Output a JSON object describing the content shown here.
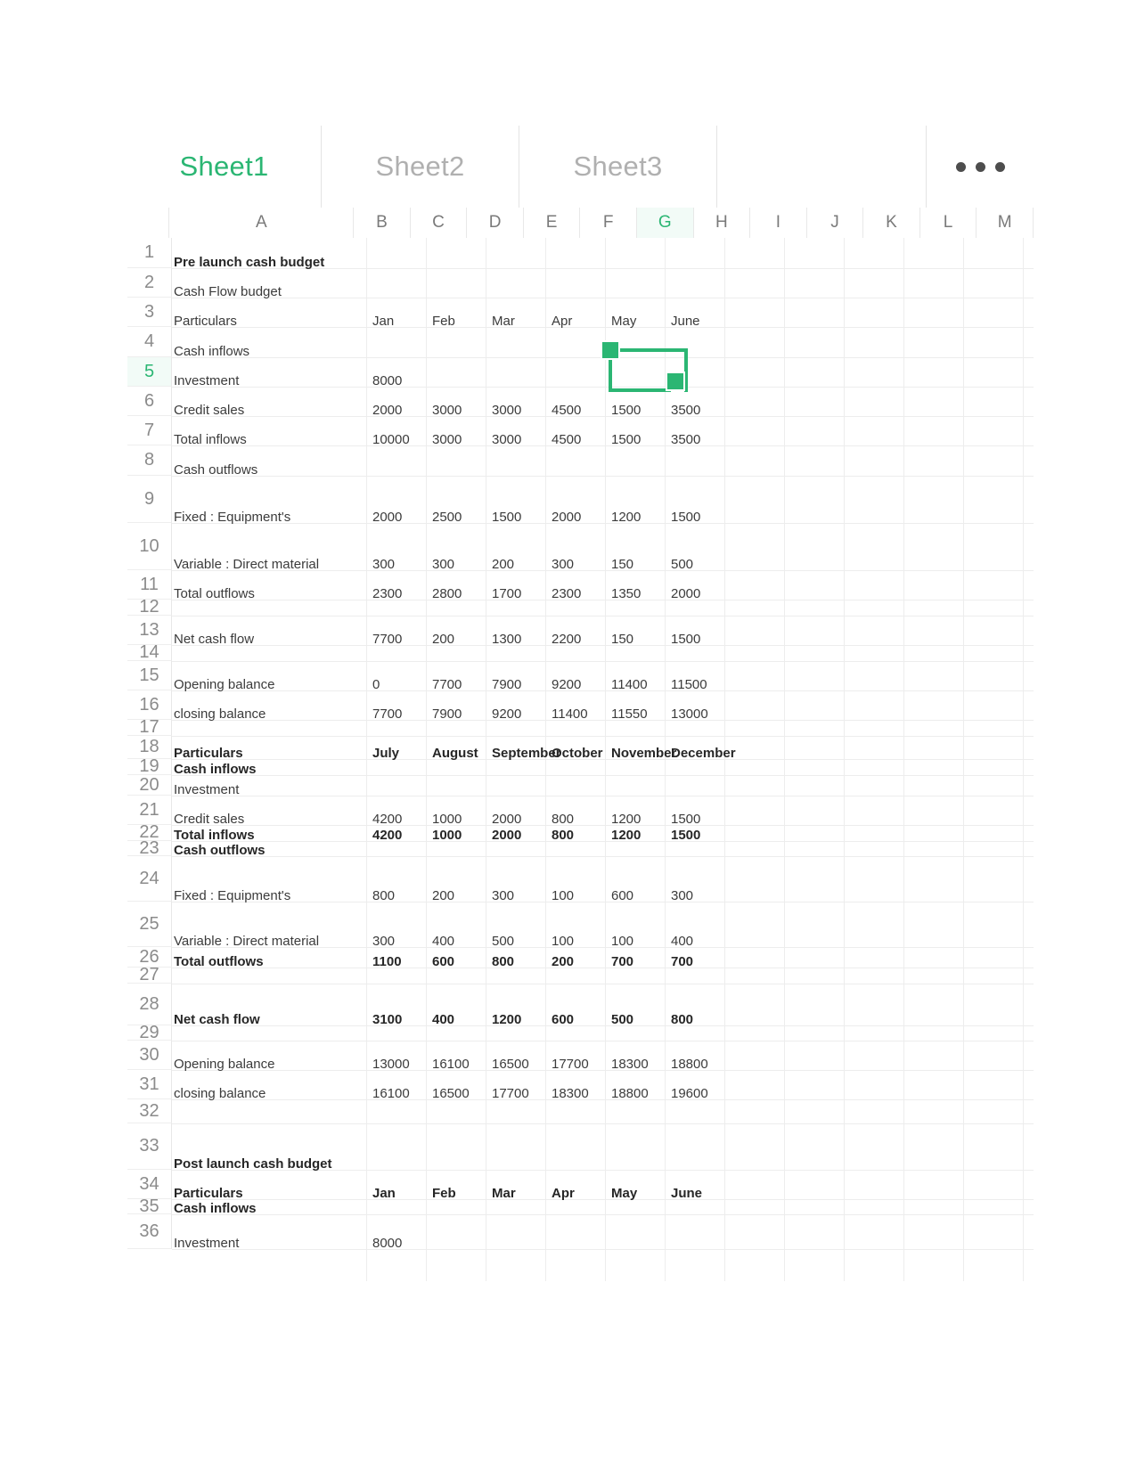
{
  "app": {
    "selected_cell_range": "G5:H6",
    "accent_color": "#2bb673",
    "grid_line_color": "#ededed",
    "header_text_color": "#7a7a7a"
  },
  "tabs": [
    {
      "label": "Sheet1",
      "active": true
    },
    {
      "label": "Sheet2",
      "active": false
    },
    {
      "label": "Sheet3",
      "active": false
    },
    {
      "label": "",
      "active": false
    }
  ],
  "more_menu": {
    "name": "more-options",
    "glyph": "•••"
  },
  "columns": [
    {
      "label": "A",
      "selected": false
    },
    {
      "label": "B",
      "selected": false
    },
    {
      "label": "C",
      "selected": false
    },
    {
      "label": "D",
      "selected": false
    },
    {
      "label": "E",
      "selected": false
    },
    {
      "label": "F",
      "selected": false
    },
    {
      "label": "G",
      "selected": true
    },
    {
      "label": "H",
      "selected": false
    },
    {
      "label": "I",
      "selected": false
    },
    {
      "label": "J",
      "selected": false
    },
    {
      "label": "K",
      "selected": false
    },
    {
      "label": "L",
      "selected": false
    },
    {
      "label": "M",
      "selected": false
    }
  ],
  "rows": [
    {
      "n": "1",
      "selected": false
    },
    {
      "n": "2",
      "selected": false
    },
    {
      "n": "3",
      "selected": false
    },
    {
      "n": "4",
      "selected": false
    },
    {
      "n": "5",
      "selected": true
    },
    {
      "n": "6",
      "selected": false
    },
    {
      "n": "7",
      "selected": false
    },
    {
      "n": "8",
      "selected": false
    },
    {
      "n": "9",
      "selected": false
    },
    {
      "n": "10",
      "selected": false
    },
    {
      "n": "11",
      "selected": false
    },
    {
      "n": "12",
      "selected": false
    },
    {
      "n": "13",
      "selected": false
    },
    {
      "n": "14",
      "selected": false
    },
    {
      "n": "15",
      "selected": false
    },
    {
      "n": "16",
      "selected": false
    },
    {
      "n": "17",
      "selected": false
    },
    {
      "n": "18",
      "selected": false
    },
    {
      "n": "19",
      "selected": false
    },
    {
      "n": "20",
      "selected": false
    },
    {
      "n": "21",
      "selected": false
    },
    {
      "n": "22",
      "selected": false
    },
    {
      "n": "23",
      "selected": false
    },
    {
      "n": "24",
      "selected": false
    },
    {
      "n": "25",
      "selected": false
    },
    {
      "n": "26",
      "selected": false
    },
    {
      "n": "27",
      "selected": false
    },
    {
      "n": "28",
      "selected": false
    },
    {
      "n": "29",
      "selected": false
    },
    {
      "n": "30",
      "selected": false
    },
    {
      "n": "31",
      "selected": false
    },
    {
      "n": "32",
      "selected": false
    },
    {
      "n": "33",
      "selected": false
    },
    {
      "n": "34",
      "selected": false
    },
    {
      "n": "35",
      "selected": false
    },
    {
      "n": "36",
      "selected": false
    }
  ],
  "sheet_rows": [
    {
      "row": 1,
      "A": "Pre launch cash budget",
      "bold": true,
      "cells": []
    },
    {
      "row": 2,
      "A": "Cash Flow budget",
      "bold": false,
      "cells": []
    },
    {
      "row": 3,
      "A": "Particulars",
      "bold": false,
      "cells": [
        "Jan",
        "Feb",
        "Mar",
        "Apr",
        "May",
        "June"
      ]
    },
    {
      "row": 4,
      "A": "Cash inflows",
      "bold": false,
      "cells": []
    },
    {
      "row": 5,
      "A": "Investment",
      "bold": false,
      "cells": [
        "8000",
        "",
        "",
        "",
        "",
        ""
      ]
    },
    {
      "row": 6,
      "A": "Credit sales",
      "bold": false,
      "cells": [
        "2000",
        "3000",
        "3000",
        "4500",
        "1500",
        "3500"
      ]
    },
    {
      "row": 7,
      "A": "Total inflows",
      "bold": false,
      "cells": [
        "10000",
        "3000",
        "3000",
        "4500",
        "1500",
        "3500"
      ]
    },
    {
      "row": 8,
      "A": "Cash outflows",
      "bold": false,
      "cells": []
    },
    {
      "row": 9,
      "A": "Fixed : Equipment's",
      "bold": false,
      "cells": [
        "2000",
        "2500",
        "1500",
        "2000",
        "1200",
        "1500"
      ]
    },
    {
      "row": 10,
      "A": "Variable : Direct material",
      "bold": false,
      "cells": [
        "300",
        "300",
        "200",
        "300",
        "150",
        "500"
      ]
    },
    {
      "row": 11,
      "A": "Total outflows",
      "bold": false,
      "cells": [
        "2300",
        "2800",
        "1700",
        "2300",
        "1350",
        "2000"
      ]
    },
    {
      "row": 12,
      "A": "",
      "bold": false,
      "cells": []
    },
    {
      "row": 13,
      "A": "Net cash flow",
      "bold": false,
      "cells": [
        "7700",
        "200",
        "1300",
        "2200",
        "150",
        "1500"
      ]
    },
    {
      "row": 14,
      "A": "",
      "bold": false,
      "cells": []
    },
    {
      "row": 15,
      "A": "Opening balance",
      "bold": false,
      "cells": [
        "0",
        "7700",
        "7900",
        "9200",
        "11400",
        "11500"
      ]
    },
    {
      "row": 16,
      "A": "closing balance",
      "bold": false,
      "cells": [
        "7700",
        "7900",
        "9200",
        "11400",
        "11550",
        "13000"
      ]
    },
    {
      "row": 17,
      "A": "",
      "bold": false,
      "cells": []
    },
    {
      "row": 18,
      "A": "Particulars",
      "bold": true,
      "cells": [
        "July",
        "August",
        "September",
        "October",
        "November",
        "December"
      ]
    },
    {
      "row": 19,
      "A": "Cash inflows",
      "bold": true,
      "cells": []
    },
    {
      "row": 20,
      "A": "Investment",
      "bold": false,
      "cells": []
    },
    {
      "row": 21,
      "A": "Credit sales",
      "bold": false,
      "cells": [
        "4200",
        "1000",
        "2000",
        "800",
        "1200",
        "1500"
      ]
    },
    {
      "row": 22,
      "A": "Total inflows",
      "bold": true,
      "cells": [
        "4200",
        "1000",
        "2000",
        "800",
        "1200",
        "1500"
      ]
    },
    {
      "row": 23,
      "A": "Cash outflows",
      "bold": true,
      "cells": []
    },
    {
      "row": 24,
      "A": "Fixed : Equipment's",
      "bold": false,
      "cells": [
        "800",
        "200",
        "300",
        "100",
        "600",
        "300"
      ]
    },
    {
      "row": 25,
      "A": "Variable : Direct material",
      "bold": false,
      "cells": [
        "300",
        "400",
        "500",
        "100",
        "100",
        "400"
      ]
    },
    {
      "row": 26,
      "A": "Total outflows",
      "bold": true,
      "cells": [
        "1100",
        "600",
        "800",
        "200",
        "700",
        "700"
      ]
    },
    {
      "row": 27,
      "A": "",
      "bold": false,
      "cells": []
    },
    {
      "row": 28,
      "A": "Net cash flow",
      "bold": true,
      "cells": [
        "3100",
        "400",
        "1200",
        "600",
        "500",
        "800"
      ]
    },
    {
      "row": 29,
      "A": "",
      "bold": false,
      "cells": []
    },
    {
      "row": 30,
      "A": "Opening balance",
      "bold": false,
      "cells": [
        "13000",
        "16100",
        "16500",
        "17700",
        "18300",
        "18800"
      ]
    },
    {
      "row": 31,
      "A": "closing balance",
      "bold": false,
      "cells": [
        "16100",
        "16500",
        "17700",
        "18300",
        "18800",
        "19600"
      ]
    },
    {
      "row": 32,
      "A": "",
      "bold": false,
      "cells": []
    },
    {
      "row": 33,
      "A": "Post launch cash budget",
      "bold": true,
      "cells": []
    },
    {
      "row": 34,
      "A": "Particulars",
      "bold": true,
      "cells": [
        "Jan",
        "Feb",
        "Mar",
        "Apr",
        "May",
        "June"
      ]
    },
    {
      "row": 35,
      "A": "Cash inflows",
      "bold": true,
      "cells": []
    },
    {
      "row": 36,
      "A": "Investment",
      "bold": false,
      "cells": [
        "8000",
        "",
        "",
        "",
        "",
        ""
      ]
    }
  ]
}
